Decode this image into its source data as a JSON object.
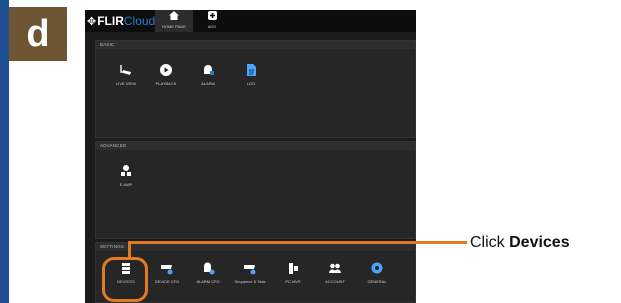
{
  "step": {
    "letter": "d"
  },
  "app": {
    "logo_flir": "FLIR",
    "logo_cloud": "Cloud",
    "nav": [
      {
        "label": "HOME PAGE",
        "icon": "home-icon"
      },
      {
        "label": "ADD",
        "icon": "add-icon"
      }
    ],
    "sections": {
      "basic": {
        "title": "BASIC",
        "items": [
          {
            "label": "LIVE VIEW",
            "icon": "camera-icon"
          },
          {
            "label": "PLAYBACK",
            "icon": "play-icon"
          },
          {
            "label": "ALARM",
            "icon": "alarm-icon"
          },
          {
            "label": "LOG",
            "icon": "log-icon"
          }
        ]
      },
      "advanced": {
        "title": "ADVANCED",
        "items": [
          {
            "label": "E-MAP",
            "icon": "map-icon"
          }
        ]
      },
      "settings": {
        "title": "SETTINGS",
        "items": [
          {
            "label": "DEVICES",
            "icon": "devices-icon"
          },
          {
            "label": "DEVICE CFG",
            "icon": "device-cfg-icon"
          },
          {
            "label": "ALARM CFG",
            "icon": "alarm-cfg-icon"
          },
          {
            "label": "Sequence & Task",
            "icon": "sequence-icon"
          },
          {
            "label": "PC-NVR",
            "icon": "pc-nvr-icon"
          },
          {
            "label": "ACCOUNT",
            "icon": "account-icon"
          },
          {
            "label": "GENERAL",
            "icon": "general-icon"
          }
        ]
      }
    }
  },
  "callout": {
    "prefix": "Click ",
    "emphasis": "Devices"
  },
  "colors": {
    "accent": "#e07b22",
    "step_badge": "#6e5634",
    "strip": "#1f4f93",
    "cloud_blue": "#2b7fd1",
    "app_bg": "#1c1c1c"
  }
}
